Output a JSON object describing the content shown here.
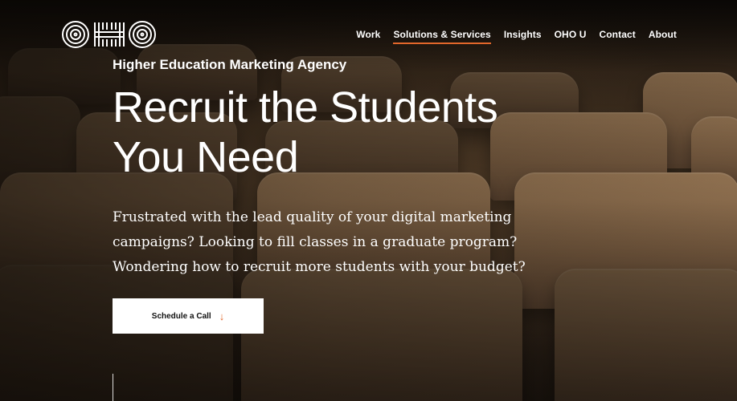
{
  "brand": {
    "logo_text": "OHO"
  },
  "nav": {
    "items": [
      {
        "label": "Work"
      },
      {
        "label": "Solutions & Services"
      },
      {
        "label": "Insights"
      },
      {
        "label": "OHO U"
      },
      {
        "label": "Contact"
      },
      {
        "label": "About"
      }
    ],
    "active_index": 1
  },
  "hero": {
    "eyebrow": "Higher Education Marketing Agency",
    "headline_line1": "Recruit the Students",
    "headline_line2": "You Need",
    "lede": "Frustrated with the lead quality of your digital marketing campaigns? Looking to fill classes in a graduate program? Wondering how to recruit more students with your budget?",
    "cta_label": "Schedule a Call",
    "cta_icon": "arrow-down-icon"
  },
  "colors": {
    "accent": "#e2672b",
    "text": "#ffffff",
    "button_bg": "#ffffff"
  }
}
